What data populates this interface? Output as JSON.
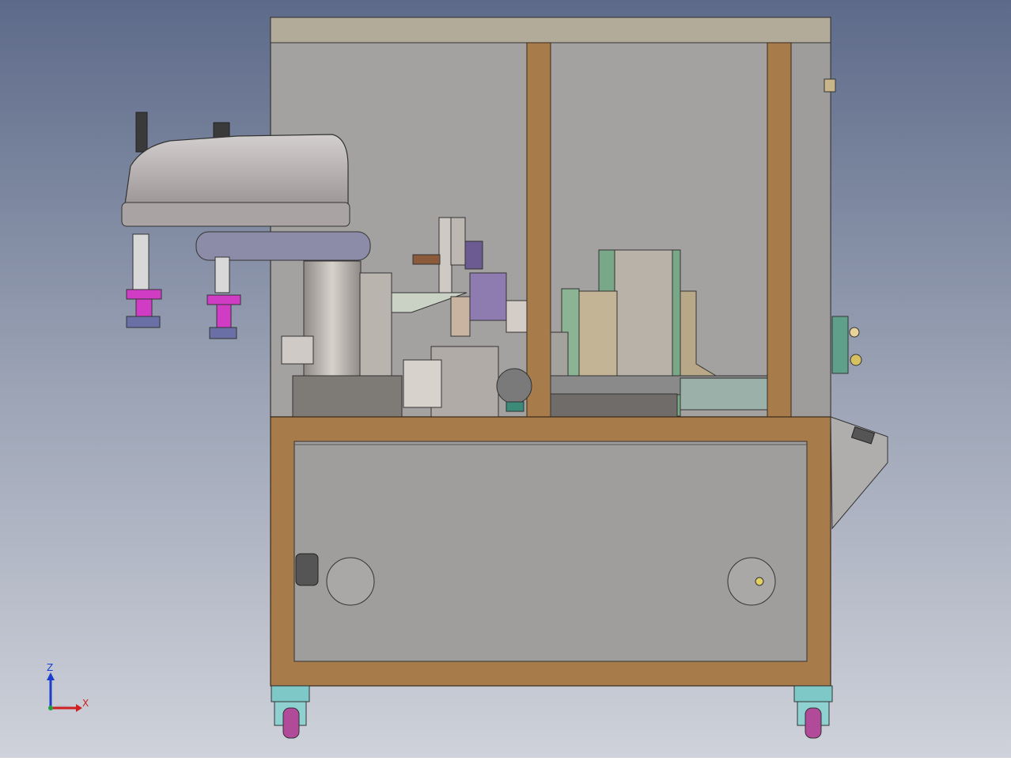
{
  "viewport": {
    "background_top": "#5f6c8a",
    "background_bottom": "#c8ccd6"
  },
  "machine": {
    "frame_color": "#a77c4a",
    "panel_color": "#9c9c9c",
    "top_cover_color": "#b3ab9a",
    "robot_color": "#bfb8b8",
    "robot_base_color": "#8c8ca8",
    "gripper_color": "#d13cc4",
    "green_part_color": "#78a888",
    "purple_part_color": "#8e7bb0",
    "caster_color": "#7fc8c8",
    "button_color": "#5fa08a"
  },
  "triad": {
    "z_label": "Z",
    "x_label": "X",
    "icon": "coordinate-triad-icon"
  }
}
